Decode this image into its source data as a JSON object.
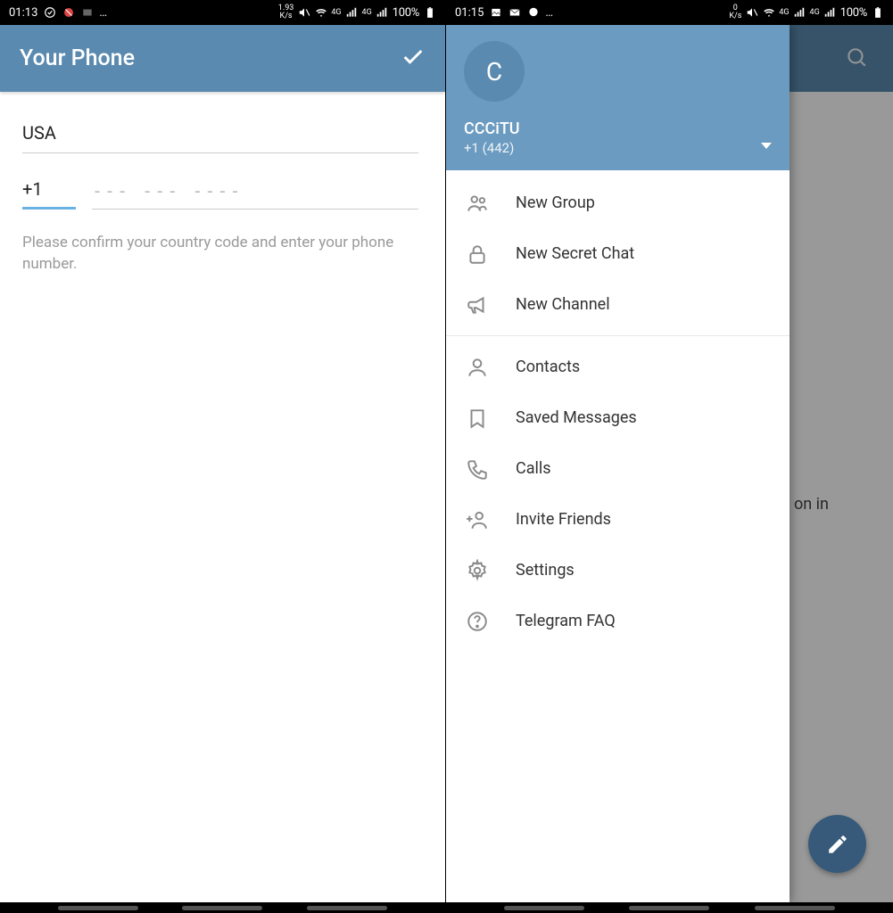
{
  "left": {
    "statusbar": {
      "time": "01:13",
      "speed_num": "1.93",
      "speed_unit": "K/s",
      "net_tag": "4G",
      "battery": "100%"
    },
    "appbar": {
      "title": "Your Phone"
    },
    "form": {
      "country": "USA",
      "code": "+1",
      "num_placeholder": "--- --- ----",
      "hint": "Please confirm your country code and enter your phone number."
    }
  },
  "right": {
    "statusbar": {
      "time": "01:15",
      "speed_num": "0",
      "speed_unit": "K/s",
      "net_tag": "4G",
      "battery": "100%"
    },
    "bg_text": "on in",
    "drawer": {
      "avatar_initial": "C",
      "name": "CCCiTU",
      "phone": "+1 (442)",
      "items_a": [
        {
          "id": "new-group",
          "label": "New Group"
        },
        {
          "id": "new-secret-chat",
          "label": "New Secret Chat"
        },
        {
          "id": "new-channel",
          "label": "New Channel"
        }
      ],
      "items_b": [
        {
          "id": "contacts",
          "label": "Contacts"
        },
        {
          "id": "saved-messages",
          "label": "Saved Messages"
        },
        {
          "id": "calls",
          "label": "Calls"
        },
        {
          "id": "invite-friends",
          "label": "Invite Friends"
        },
        {
          "id": "settings",
          "label": "Settings"
        },
        {
          "id": "telegram-faq",
          "label": "Telegram FAQ"
        }
      ]
    }
  }
}
